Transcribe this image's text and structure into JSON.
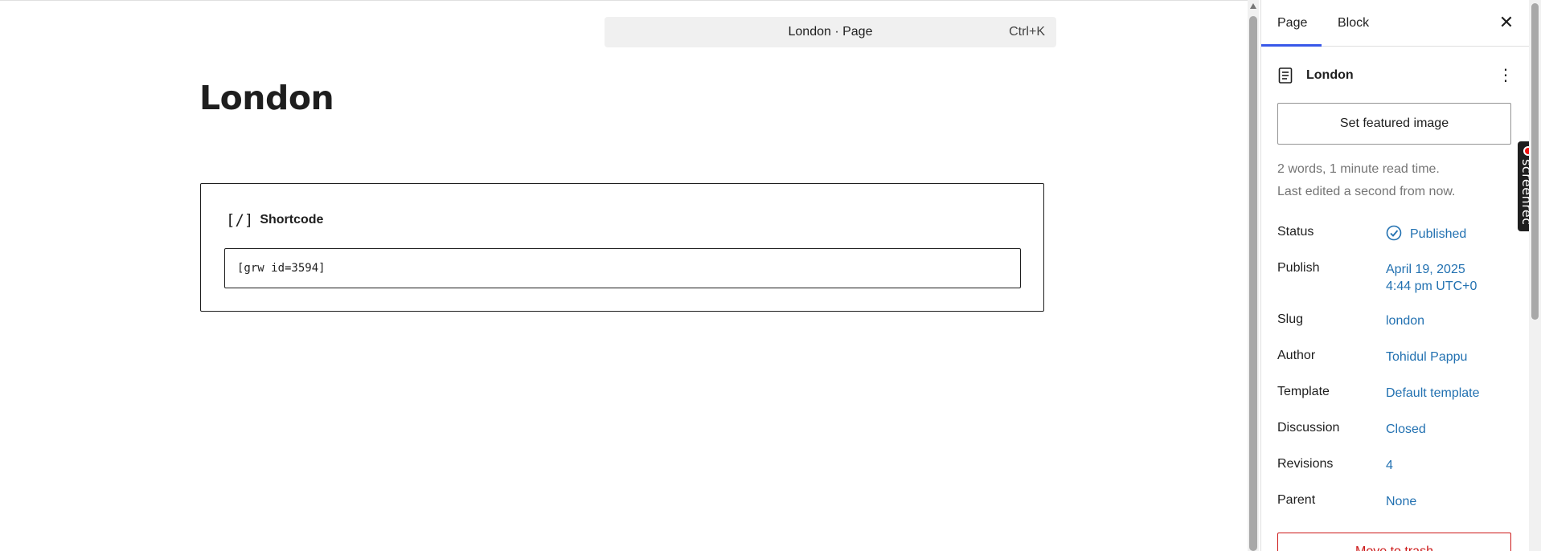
{
  "command_bar": {
    "title": "London · Page",
    "shortcut": "Ctrl+K"
  },
  "post": {
    "title": "London"
  },
  "shortcode_block": {
    "icon": "[/]",
    "label": "Shortcode",
    "value": "[grw id=3594]"
  },
  "sidebar": {
    "tabs": {
      "page": "Page",
      "block": "Block"
    },
    "close": "✕",
    "document": {
      "title": "London",
      "more": "⋮"
    },
    "featured_image_button": "Set featured image",
    "meta": {
      "words": "2 words, 1 minute read time.",
      "edited": "Last edited a second from now."
    },
    "properties": {
      "status": {
        "label": "Status",
        "value": "Published"
      },
      "publish": {
        "label": "Publish",
        "value_line1": "April 19, 2025",
        "value_line2": "4:44 pm UTC+0"
      },
      "slug": {
        "label": "Slug",
        "value": "london"
      },
      "author": {
        "label": "Author",
        "value": "Tohidul Pappu"
      },
      "template": {
        "label": "Template",
        "value": "Default template"
      },
      "discussion": {
        "label": "Discussion",
        "value": "Closed"
      },
      "revisions": {
        "label": "Revisions",
        "value": "4"
      },
      "parent": {
        "label": "Parent",
        "value": "None"
      }
    },
    "trash_button": "Move to trash"
  },
  "screenrec": {
    "label": "screenrec"
  },
  "colors": {
    "accent": "#3858e9",
    "link": "#2271b1",
    "danger": "#cc1818",
    "muted": "#757575"
  }
}
